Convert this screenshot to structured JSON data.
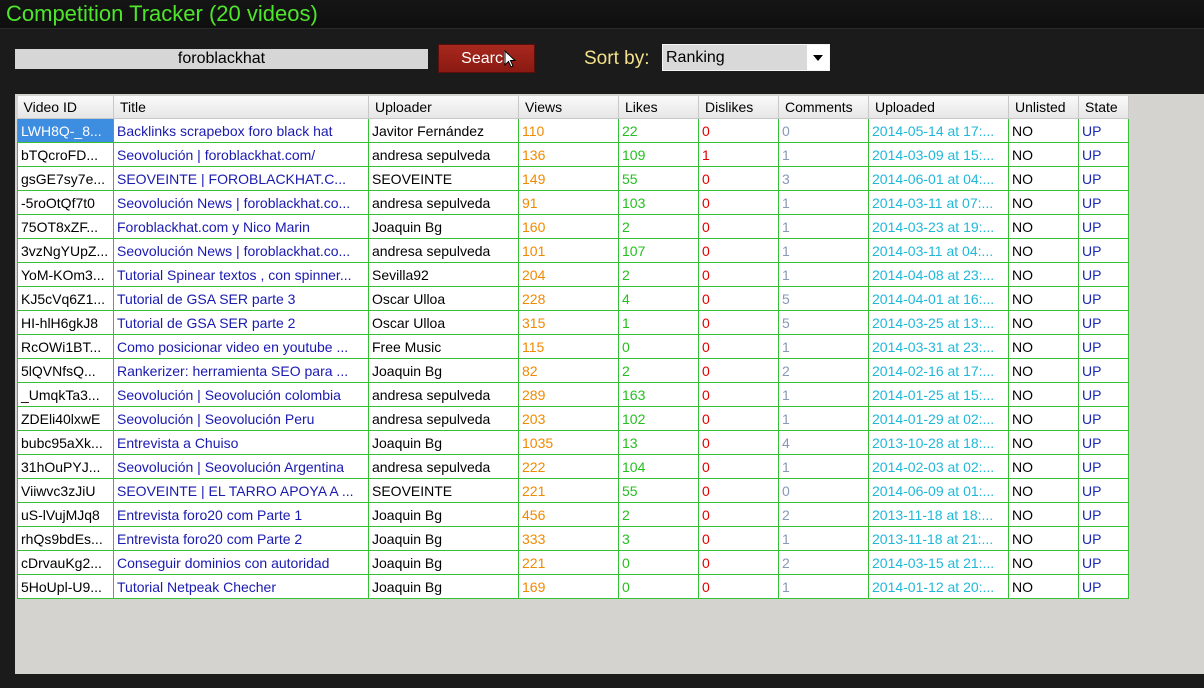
{
  "window": {
    "title": "Competition Tracker (20 videos)"
  },
  "search": {
    "value": "foroblackhat",
    "button_label": "Search"
  },
  "sort": {
    "label": "Sort by:",
    "selected": "Ranking"
  },
  "table": {
    "columns": [
      "Video ID",
      "Title",
      "Uploader",
      "Views",
      "Likes",
      "Dislikes",
      "Comments",
      "Uploaded",
      "Unlisted",
      "State"
    ],
    "rows": [
      [
        "LWH8Q-_8...",
        "Backlinks scrapebox foro black hat",
        "Javitor Fernández",
        "110",
        "22",
        "0",
        "0",
        "2014-05-14 at 17:...",
        "NO",
        "UP"
      ],
      [
        "bTQcroFD...",
        "Seovolución | foroblackhat.com/",
        "andresa sepulveda",
        "136",
        "109",
        "1",
        "1",
        "2014-03-09 at 15:...",
        "NO",
        "UP"
      ],
      [
        "gsGE7sy7e...",
        "SEOVEINTE | FOROBLACKHAT.C...",
        "SEOVEINTE",
        "149",
        "55",
        "0",
        "3",
        "2014-06-01 at 04:...",
        "NO",
        "UP"
      ],
      [
        "-5roOtQf7t0",
        "Seovolución News | foroblackhat.co...",
        "andresa sepulveda",
        "91",
        "103",
        "0",
        "1",
        "2014-03-11 at 07:...",
        "NO",
        "UP"
      ],
      [
        "75OT8xZF...",
        "Foroblackhat.com y Nico Marin",
        "Joaquin Bg",
        "160",
        "2",
        "0",
        "1",
        "2014-03-23 at 19:...",
        "NO",
        "UP"
      ],
      [
        "3vzNgYUpZ...",
        "Seovolución News | foroblackhat.co...",
        "andresa sepulveda",
        "101",
        "107",
        "0",
        "1",
        "2014-03-11 at 04:...",
        "NO",
        "UP"
      ],
      [
        "YoM-KOm3...",
        "Tutorial Spinear textos , con spinner...",
        "Sevilla92",
        "204",
        "2",
        "0",
        "1",
        "2014-04-08 at 23:...",
        "NO",
        "UP"
      ],
      [
        "KJ5cVq6Z1...",
        "Tutorial de GSA SER parte 3",
        "Oscar Ulloa",
        "228",
        "4",
        "0",
        "5",
        "2014-04-01 at 16:...",
        "NO",
        "UP"
      ],
      [
        "HI-hlH6gkJ8",
        "Tutorial de GSA SER parte 2",
        "Oscar Ulloa",
        "315",
        "1",
        "0",
        "5",
        "2014-03-25 at 13:...",
        "NO",
        "UP"
      ],
      [
        "RcOWi1BT...",
        "Como posicionar video en youtube ...",
        "Free Music",
        "115",
        "0",
        "0",
        "1",
        "2014-03-31 at 23:...",
        "NO",
        "UP"
      ],
      [
        "5lQVNfsQ...",
        "Rankerizer: herramienta SEO para ...",
        "Joaquin Bg",
        "82",
        "2",
        "0",
        "2",
        "2014-02-16 at 17:...",
        "NO",
        "UP"
      ],
      [
        "_UmqkTa3...",
        "Seovolución | Seovolución colombia",
        "andresa sepulveda",
        "289",
        "163",
        "0",
        "1",
        "2014-01-25 at 15:...",
        "NO",
        "UP"
      ],
      [
        "ZDEli40lxwE",
        "Seovolución | Seovolución Peru",
        "andresa sepulveda",
        "203",
        "102",
        "0",
        "1",
        "2014-01-29 at 02:...",
        "NO",
        "UP"
      ],
      [
        "bubc95aXk...",
        "Entrevista a Chuiso",
        "Joaquin Bg",
        "1035",
        "13",
        "0",
        "4",
        "2013-10-28 at 18:...",
        "NO",
        "UP"
      ],
      [
        "31hOuPYJ...",
        "Seovolución | Seovolución Argentina",
        "andresa sepulveda",
        "222",
        "104",
        "0",
        "1",
        "2014-02-03 at 02:...",
        "NO",
        "UP"
      ],
      [
        "Viiwvc3zJiU",
        "SEOVEINTE | EL TARRO APOYA A ...",
        "SEOVEINTE",
        "221",
        "55",
        "0",
        "0",
        "2014-06-09 at 01:...",
        "NO",
        "UP"
      ],
      [
        "uS-lVujMJq8",
        "Entrevista foro20 com Parte 1",
        "Joaquin Bg",
        "456",
        "2",
        "0",
        "2",
        "2013-11-18 at 18:...",
        "NO",
        "UP"
      ],
      [
        "rhQs9bdEs...",
        "Entrevista foro20 com Parte 2",
        "Joaquin Bg",
        "333",
        "3",
        "0",
        "1",
        "2013-11-18 at 21:...",
        "NO",
        "UP"
      ],
      [
        "cDrvauKg2...",
        "Conseguir dominios con autoridad",
        "Joaquin Bg",
        "221",
        "0",
        "0",
        "2",
        "2014-03-15 at 21:...",
        "NO",
        "UP"
      ],
      [
        "5HoUpl-U9...",
        "Tutorial Netpeak Checher",
        "Joaquin Bg",
        "169",
        "0",
        "0",
        "1",
        "2014-01-12 at 20:...",
        "NO",
        "UP"
      ]
    ]
  },
  "colors": {
    "title_green": "#4ee62a",
    "search_button": "#a8281e",
    "grid_border": "#34c234",
    "title_link": "#1a1ab0",
    "views": "#f08a00",
    "likes": "#24c020",
    "dislikes": "#e00000",
    "uploaded": "#20b8d8"
  }
}
